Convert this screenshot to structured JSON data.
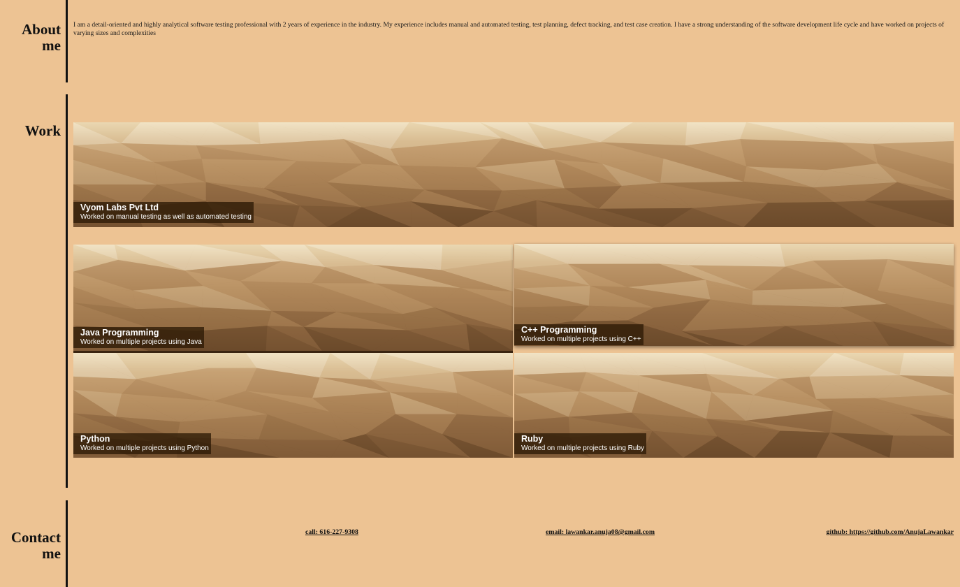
{
  "about": {
    "title": "About me",
    "text": "I am a detail-oriented and highly analytical software testing professional with 2 years of experience in the industry. My experience includes manual and automated testing, test planning, defect tracking, and test case creation. I have a strong understanding of the software development life cycle and have worked on projects of varying sizes and complexities"
  },
  "work": {
    "title": "Work",
    "items": [
      {
        "title": "Vyom Labs Pvt Ltd",
        "subtitle": "Worked on manual testing as well as automated testing"
      },
      {
        "title": "Java Programming",
        "subtitle": "Worked on multiple projects using Java"
      },
      {
        "title": "C++ Programming",
        "subtitle": "Worked on multiple projects using C++"
      },
      {
        "title": "Python",
        "subtitle": "Worked on multiple projects using Python"
      },
      {
        "title": "Ruby",
        "subtitle": "Worked on multiple projects using Ruby"
      }
    ]
  },
  "contact": {
    "title": "Contact me",
    "call": "call: 616-227-9308",
    "email": "email: lawankar.anuja08@gmail.com",
    "github": "github: https://github.com/AnujaLawankar"
  },
  "colors": {
    "background": "#edc393",
    "divider": "#111111",
    "caption_bg": "#2d1905"
  }
}
